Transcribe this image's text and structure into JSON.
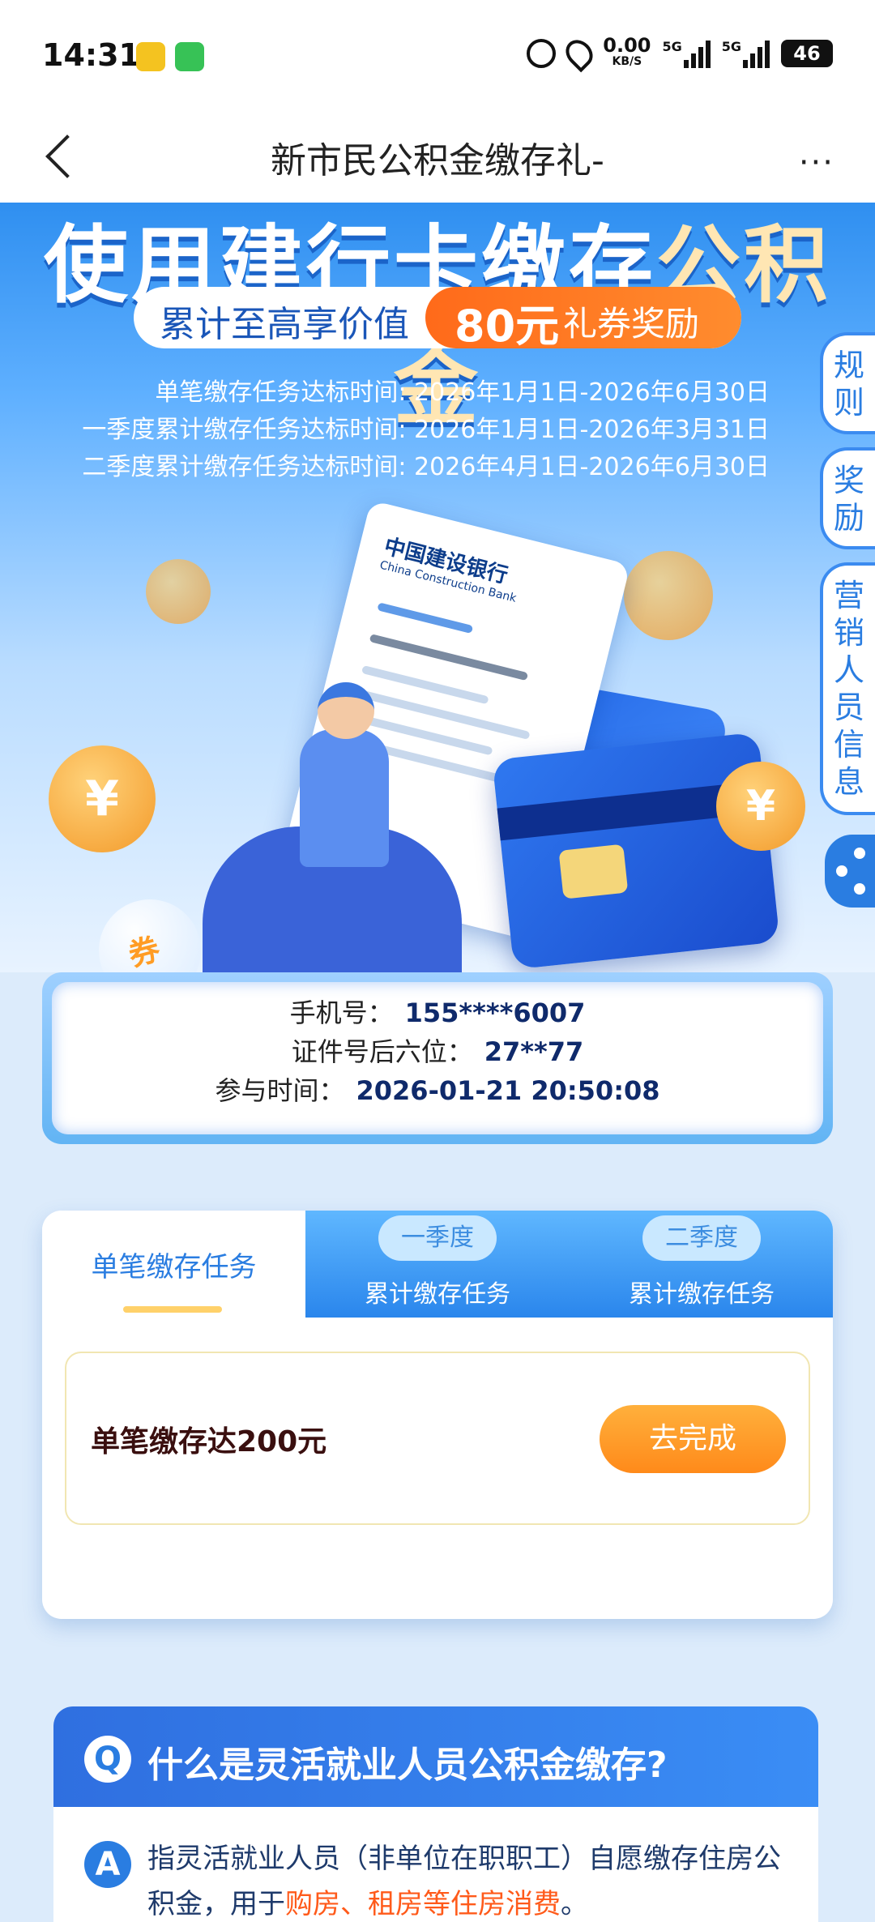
{
  "status_bar": {
    "time": "14:31",
    "speed_value": "0.00",
    "speed_unit": "KB/S",
    "signal1": "5G",
    "signal2": "5G",
    "battery": "46"
  },
  "nav": {
    "title": "新市民公积金缴存礼-",
    "more": "···"
  },
  "hero": {
    "title_main": "使用建行卡缴存",
    "title_highlight": "公积金",
    "pill_left": "累计至高享价值",
    "pill_amount": "80元",
    "pill_reward": "礼券奖励",
    "time_rows": [
      "单笔缴存任务达标时间: 2026年1月1日-2026年6月30日",
      "一季度累计缴存任务达标时间: 2026年1月1日-2026年3月31日",
      "二季度累计缴存任务达标时间: 2026年4月1日-2026年6月30日"
    ],
    "bank_name_cn": "中国建设银行",
    "bank_name_en": "China Construction Bank",
    "bubble_text": "券",
    "coin_symbol": "¥"
  },
  "side_tabs": {
    "rules": "规则",
    "rewards": "奖励",
    "sales_info": "营销人员信息"
  },
  "info": {
    "phone_label": "手机号：",
    "phone_value": "155****6007",
    "id_label": "证件号后六位：",
    "id_value": "27**77",
    "join_label": "参与时间：",
    "join_value": "2026-01-21 20:50:08"
  },
  "tasks": {
    "tab_single": "单笔缴存任务",
    "tab_q1_chip": "一季度",
    "tab_q1_text": "累计缴存任务",
    "tab_q2_chip": "二季度",
    "tab_q2_text": "累计缴存任务",
    "item_label": "单笔缴存达200元",
    "item_button": "去完成"
  },
  "faq": {
    "q_badge": "Q",
    "question": "什么是灵活就业人员公积金缴存?",
    "a_badge": "A",
    "answer_part1": "指灵活就业人员（非单位在职职工）自愿缴存住房公积金，用于",
    "answer_highlight": "购房、租房等住房消费",
    "answer_part2": "。"
  }
}
